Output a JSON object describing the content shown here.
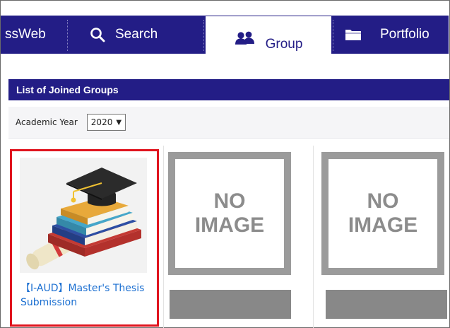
{
  "nav": {
    "items": [
      {
        "label": "ssWeb",
        "icon": ""
      },
      {
        "label": "Search",
        "icon": "search-icon"
      },
      {
        "label": "Group",
        "icon": "group-icon",
        "active": true
      },
      {
        "label": "Portfolio",
        "icon": "folder-icon"
      }
    ]
  },
  "panel": {
    "title": "List of Joined Groups",
    "filter_label": "Academic Year",
    "year_value": "2020"
  },
  "cards": [
    {
      "title": "【I-AUD】Master's Thesis Submission",
      "selected": true
    },
    {
      "placeholder": "NO IMAGE"
    },
    {
      "placeholder": "NO IMAGE"
    }
  ],
  "colors": {
    "nav_bg": "#231d86",
    "selected_border": "#e0141e",
    "link": "#1b6fd1"
  }
}
